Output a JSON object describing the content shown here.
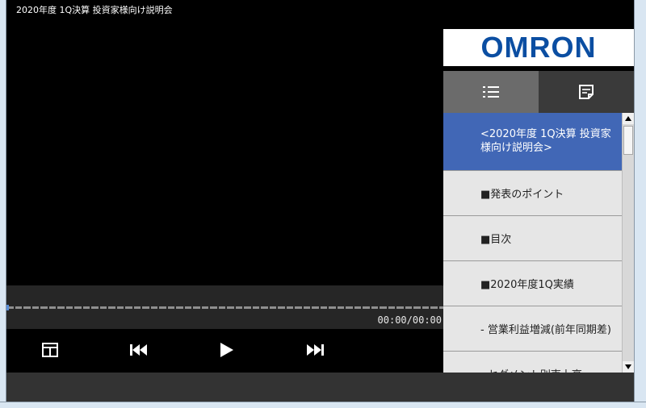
{
  "window": {
    "title": "2020年度 1Q決算 投資家様向け説明会"
  },
  "player": {
    "time": "00:00/00:00",
    "controls": {
      "layout_icon": "layout-icon",
      "prev_icon": "skip-previous-icon",
      "play_icon": "play-icon",
      "next_icon": "skip-next-icon"
    },
    "progress": 0
  },
  "panel": {
    "logo": "OMRON",
    "tabs": [
      {
        "icon": "list-icon",
        "active": true
      },
      {
        "icon": "note-icon",
        "active": false
      }
    ],
    "items": [
      {
        "label": "<2020年度 1Q決算 投資家様向け説明会>",
        "active": true
      },
      {
        "label": "■発表のポイント"
      },
      {
        "label": "■目次"
      },
      {
        "label": "■2020年度1Q実績"
      },
      {
        "label": "- 営業利益増減(前年同期差)"
      },
      {
        "label": "- セグメント別売上高"
      }
    ]
  },
  "colors": {
    "accent": "#4167b6",
    "logo": "#0b4ea2",
    "seek": "#5a8ed8"
  }
}
